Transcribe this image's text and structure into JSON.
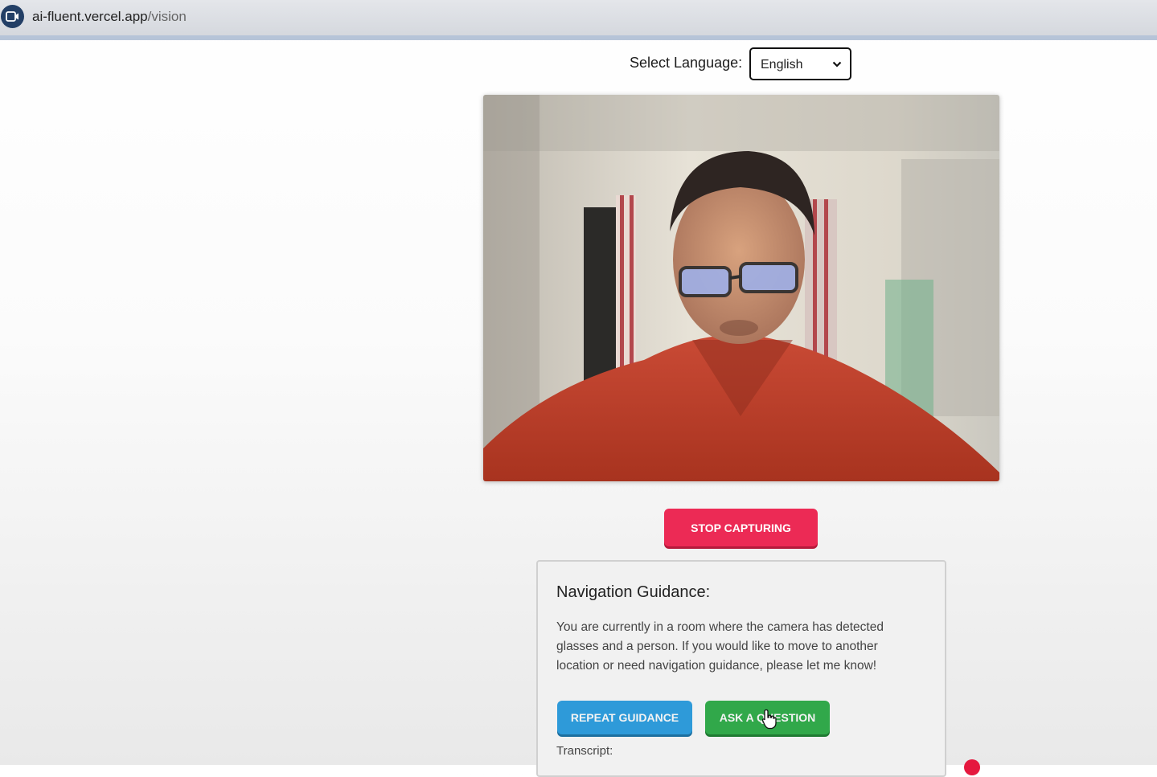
{
  "browser": {
    "url_host": "ai-fluent.vercel.app",
    "url_path": "/vision"
  },
  "language": {
    "label": "Select Language:",
    "selected": "English"
  },
  "camera": {
    "description_icon": "video-feed"
  },
  "controls": {
    "stop_label": "STOP CAPTURING"
  },
  "guidance": {
    "title": "Navigation Guidance:",
    "text": "You are currently in a room where the camera has detected glasses and a person. If you would like to move to another location or need navigation guidance, please let me know!",
    "repeat_label": "REPEAT GUIDANCE",
    "ask_label": "ASK A QUESTION",
    "transcript_label": "Transcript:"
  },
  "colors": {
    "stop": "#ec2a55",
    "repeat": "#2e9ad9",
    "ask": "#31a84a"
  }
}
